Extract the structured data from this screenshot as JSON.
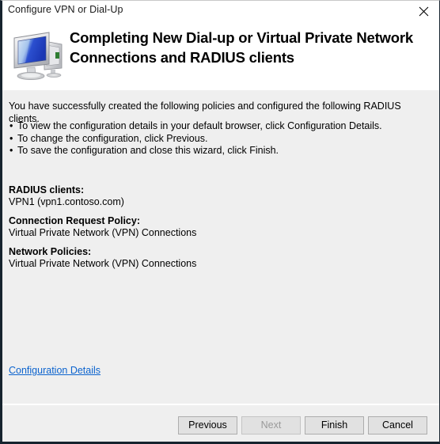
{
  "window": {
    "title": "Configure VPN or Dial-Up",
    "close_icon": "close-icon"
  },
  "header": {
    "icon": "computer-network-icon",
    "heading": "Completing New Dial-up or Virtual Private Network Connections and RADIUS clients"
  },
  "body": {
    "intro": "You have successfully created the following policies and configured the following RADIUS clients.",
    "bullets": [
      "To view the configuration details in your default browser, click Configuration Details.",
      "To change the configuration, click Previous.",
      "To save the configuration and close this wizard, click Finish."
    ],
    "bullet_glyph": "•",
    "summary": [
      {
        "heading": "RADIUS clients:",
        "value": "VPN1 (vpn1.contoso.com)"
      },
      {
        "heading": "Connection Request Policy:",
        "value": "Virtual Private Network (VPN) Connections"
      },
      {
        "heading": "Network Policies:",
        "value": "Virtual Private Network (VPN) Connections"
      }
    ],
    "config_details_link": "Configuration Details"
  },
  "footer": {
    "buttons": [
      {
        "label": "Previous",
        "disabled": false
      },
      {
        "label": "Next",
        "disabled": true
      },
      {
        "label": "Finish",
        "disabled": false
      },
      {
        "label": "Cancel",
        "disabled": false
      }
    ]
  },
  "colors": {
    "link": "#0b63ce",
    "body_bg": "#efefef",
    "header_bg": "#ffffff",
    "border": "#16232e"
  }
}
